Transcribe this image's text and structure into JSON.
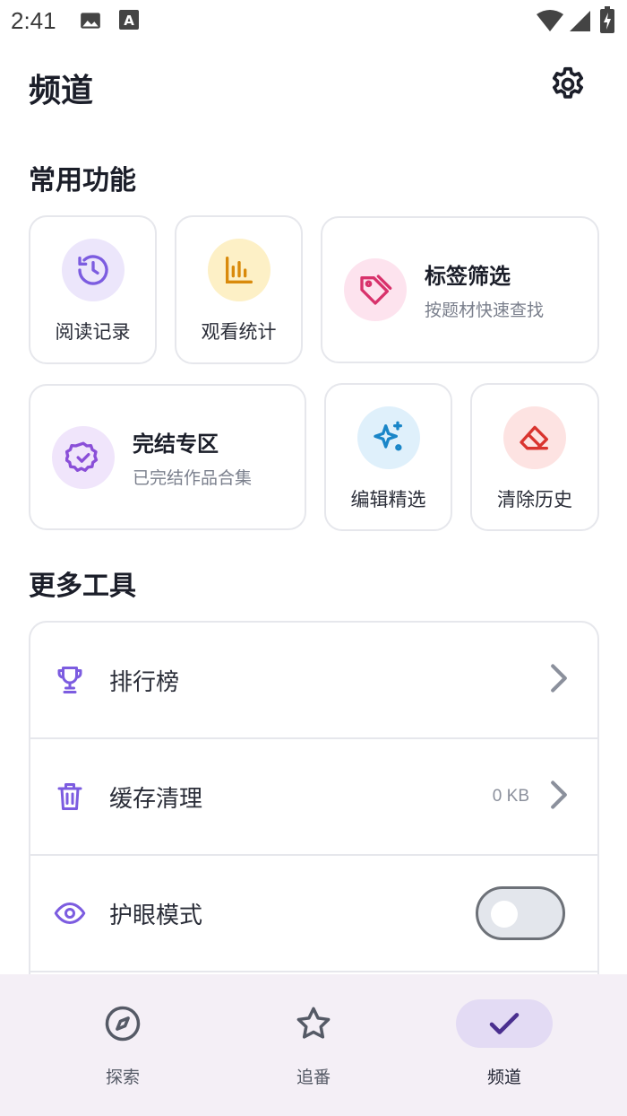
{
  "status_bar": {
    "time": "2:41",
    "icons": [
      "image-icon",
      "accessibility-a-icon",
      "wifi-icon",
      "signal-icon",
      "battery-charging-icon"
    ]
  },
  "header": {
    "title": "频道",
    "settings_icon": "gear-icon"
  },
  "common": {
    "section_title": "常用功能",
    "tiles": [
      {
        "label": "阅读记录",
        "icon": "history-icon",
        "color": "#7c5ce0",
        "bg": "#ece6fb"
      },
      {
        "label": "观看统计",
        "icon": "bar-chart-icon",
        "color": "#d98a0b",
        "bg": "#fdf0c6"
      },
      {
        "title": "标签筛选",
        "subtitle": "按题材快速查找",
        "icon": "tag-icon",
        "color": "#d8326b",
        "bg": "#fde3ee"
      },
      {
        "title": "完结专区",
        "subtitle": "已完结作品合集",
        "icon": "badge-check-icon",
        "color": "#8a4fd8",
        "bg": "#f0e5fb"
      },
      {
        "label": "编辑精选",
        "icon": "sparkles-icon",
        "color": "#1a86c8",
        "bg": "#dff0fb"
      },
      {
        "label": "清除历史",
        "icon": "eraser-icon",
        "color": "#d9342f",
        "bg": "#fde3e2"
      }
    ]
  },
  "more": {
    "section_title": "更多工具",
    "rows": [
      {
        "label": "排行榜",
        "icon": "trophy-icon"
      },
      {
        "label": "缓存清理",
        "icon": "trash-icon",
        "value": "0 KB"
      },
      {
        "label": "护眼模式",
        "icon": "eye-icon",
        "toggle_on": false
      }
    ]
  },
  "bottom_nav": {
    "items": [
      {
        "label": "探索",
        "icon": "compass-icon",
        "active": false
      },
      {
        "label": "追番",
        "icon": "star-icon",
        "active": false
      },
      {
        "label": "频道",
        "icon": "check-icon",
        "active": true
      }
    ]
  },
  "colors": {
    "accent": "#7c5ce0",
    "nav_active_bg": "#e3dbf4",
    "nav_bg": "#f4eff6"
  }
}
